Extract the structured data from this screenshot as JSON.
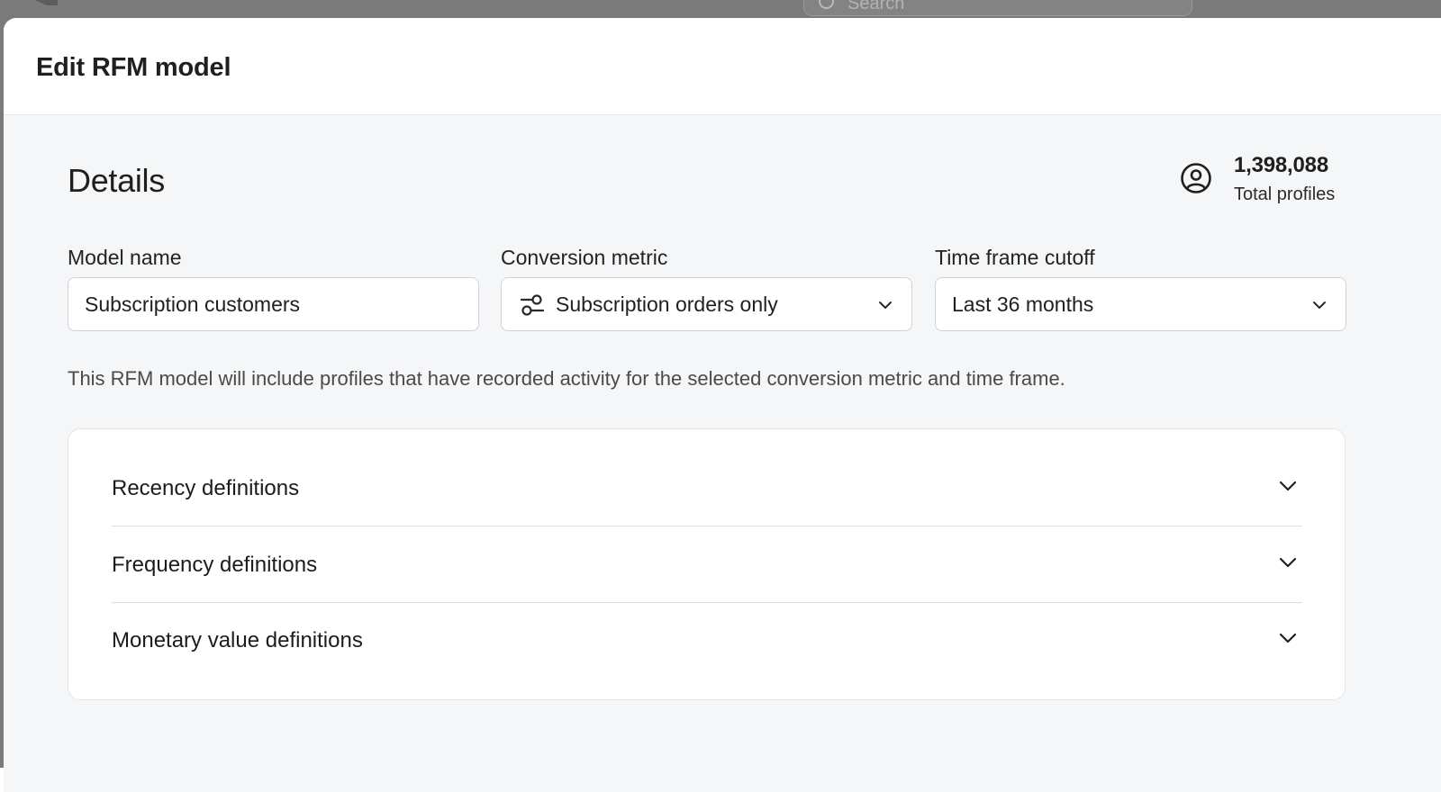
{
  "background": {
    "search_placeholder": "Search"
  },
  "modal": {
    "title": "Edit RFM model"
  },
  "details": {
    "section_title": "Details",
    "profiles": {
      "count": "1,398,088",
      "label": "Total profiles"
    },
    "model_name": {
      "label": "Model name",
      "value": "Subscription customers"
    },
    "conversion_metric": {
      "label": "Conversion metric",
      "value": "Subscription orders only",
      "icon": "filter-settings-icon"
    },
    "time_frame": {
      "label": "Time frame cutoff",
      "value": "Last 36 months"
    },
    "helper_text": "This RFM model will include profiles that have recorded activity for the selected conversion metric and time frame."
  },
  "definitions": [
    {
      "label": "Recency definitions"
    },
    {
      "label": "Frequency definitions"
    },
    {
      "label": "Monetary value definitions"
    }
  ],
  "colors": {
    "backdrop": "#7a7a7a",
    "modal_body": "#f5f6f7",
    "card": "#ffffff",
    "border": "#cfd2d6"
  }
}
